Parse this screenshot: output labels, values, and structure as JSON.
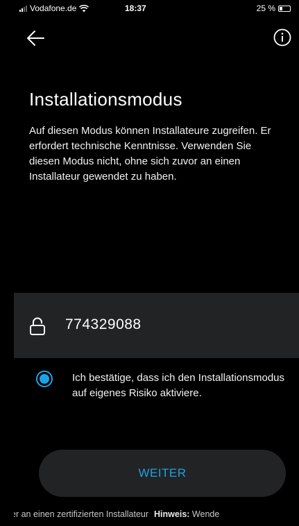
{
  "status_bar": {
    "carrier": "Vodafone.de",
    "time": "18:37",
    "battery": "25 %",
    "battery_level": 0.25
  },
  "nav": {
    "back_icon": "arrow-left-icon",
    "info_icon": "info-circle-icon"
  },
  "main": {
    "title": "Installationsmodus",
    "description": "Auf diesen Modus können Installateure zugreifen. Er erfordert technische Kenntnisse. Verwenden Sie diesen Modus nicht, ohne sich zuvor an einen Installateur gewendet zu haben."
  },
  "pin": {
    "icon": "lock-icon",
    "value": "774329088"
  },
  "confirm": {
    "checked": true,
    "label": "Ich bestätige, dass ich den Installationsmodus auf eigenes Risiko aktiviere."
  },
  "button": {
    "label": "WEITER"
  },
  "ticker": {
    "text": "er an einen zertifizierten Installateur",
    "hint_label": "Hinweis:",
    "hint_text": "Wende"
  },
  "colors": {
    "accent": "#1ca3e6",
    "background": "#000000",
    "panel": "#222324"
  }
}
